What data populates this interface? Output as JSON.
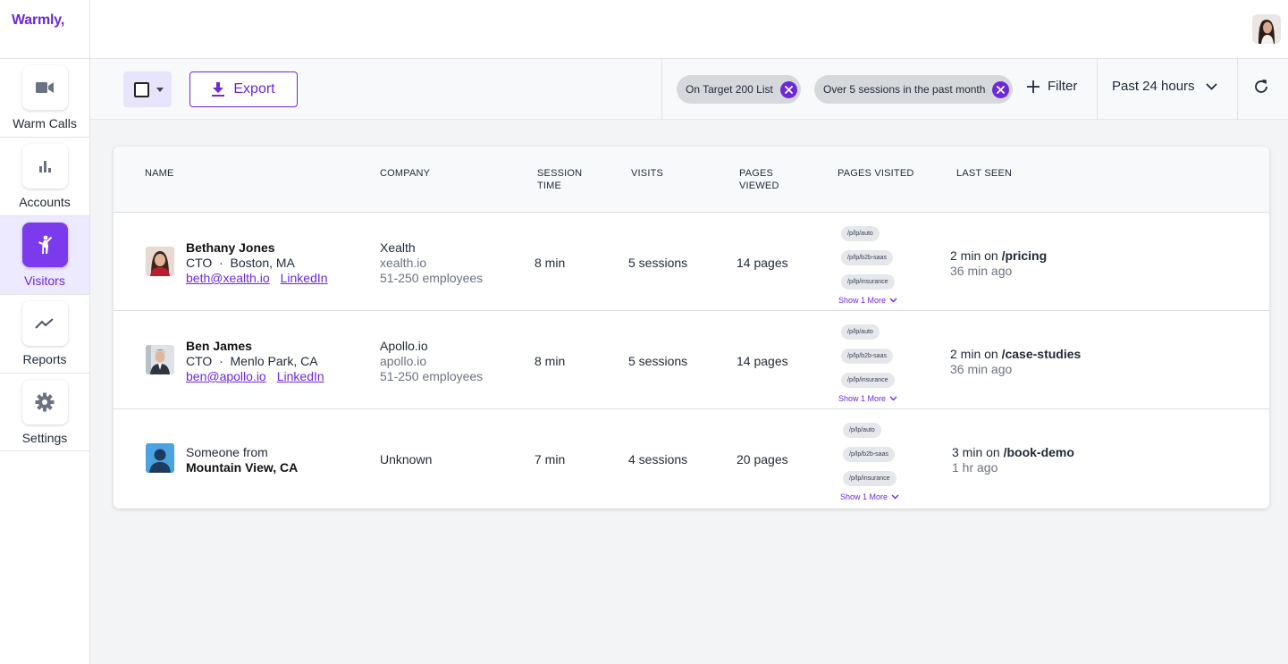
{
  "app": {
    "logo": "Warmly,"
  },
  "sidebar": {
    "items": [
      {
        "label": "Warm Calls",
        "icon": "video-camera-icon",
        "active": false
      },
      {
        "label": "Accounts",
        "icon": "bar-chart-icon",
        "active": false
      },
      {
        "label": "Visitors",
        "icon": "visitor-person-icon",
        "active": true
      },
      {
        "label": "Reports",
        "icon": "trend-line-icon",
        "active": false
      },
      {
        "label": "Settings",
        "icon": "gear-icon",
        "active": false
      }
    ]
  },
  "toolbar": {
    "export_label": "Export",
    "filters": [
      {
        "label": "On Target 200 List"
      },
      {
        "label": "Over 5 sessions in the past month"
      }
    ],
    "filter_label": "Filter",
    "time_range": "Past 24 hours"
  },
  "table": {
    "headers": {
      "name": "NAME",
      "company": "COMPANY",
      "session_time": "SESSION TIME",
      "visits": "VISITS",
      "pages_viewed": "PAGES VIEWED",
      "pages_visited": "PAGES VISITED",
      "last_seen": "LAST SEEN"
    },
    "rows": [
      {
        "name": "Bethany Jones",
        "title_location": "CTO  ·  Boston, MA",
        "email": "beth@xealth.io",
        "linkedin": "LinkedIn",
        "company": "Xealth",
        "domain": "xealth.io",
        "employees": "51-250 employees",
        "session_time": "8 min",
        "visits": "5 sessions",
        "pages_viewed": "14 pages",
        "pages": [
          "/p/lp/auto",
          "/p/lp/b2b-saas",
          "/p/lp/insurance"
        ],
        "show_more": "Show 1 More",
        "last_seen_prefix": "2 min on ",
        "last_seen_page": "/pricing",
        "last_seen_ago": "36 min ago"
      },
      {
        "name": "Ben James",
        "title_location": "CTO  ·  Menlo Park, CA",
        "email": "ben@apollo.io",
        "linkedin": "LinkedIn",
        "company": "Apollo.io",
        "domain": "apollo.io",
        "employees": "51-250 employees",
        "session_time": "8 min",
        "visits": "5 sessions",
        "pages_viewed": "14 pages",
        "pages": [
          "/p/lp/auto",
          "/p/lp/b2b-saas",
          "/p/lp/insurance"
        ],
        "show_more": "Show 1 More",
        "last_seen_prefix": "2 min on ",
        "last_seen_page": "/case-studies",
        "last_seen_ago": "36 min ago"
      },
      {
        "name_prefix": "Someone from",
        "name_location": "Mountain View, CA",
        "company": "Unknown",
        "session_time": "7 min",
        "visits": "4 sessions",
        "pages_viewed": "20 pages",
        "pages": [
          "/p/lp/auto",
          "/p/lp/b2b-saas",
          "/p/lp/insurance"
        ],
        "show_more": "Show 1 More",
        "last_seen_prefix": "3 min on ",
        "last_seen_page": "/book-demo",
        "last_seen_ago": "1 hr ago"
      }
    ]
  },
  "colors": {
    "accent": "#6d28d9",
    "accent_light": "#ede9fe"
  }
}
